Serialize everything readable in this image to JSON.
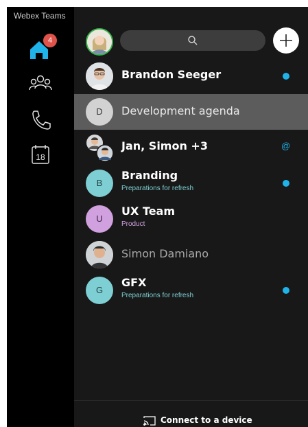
{
  "app": {
    "title": "Webex Teams"
  },
  "sidebar": {
    "items": [
      {
        "name": "home",
        "icon": "home-icon",
        "badge": "4",
        "color": "#20b3ea"
      },
      {
        "name": "teams",
        "icon": "people-icon"
      },
      {
        "name": "calls",
        "icon": "phone-icon"
      },
      {
        "name": "meetings",
        "icon": "calendar-icon",
        "label": "18"
      }
    ]
  },
  "header": {
    "search_icon": "search-icon",
    "add_icon": "plus-icon"
  },
  "spaces": [
    {
      "name": "Brandon Seeger",
      "style": "bold",
      "avatar": "photo",
      "unread": "dot"
    },
    {
      "name": "Development agenda",
      "style": "light",
      "avatar_initial": "D",
      "avatar_color": "#d2d2d2",
      "selected": true
    },
    {
      "name": "Jan, Simon +3",
      "style": "bold",
      "avatar": "group-photo",
      "unread": "@"
    },
    {
      "name": "Branding",
      "style": "bold",
      "avatar_initial": "B",
      "avatar_color": "#7ecfd3",
      "subtitle": "Preparations for refresh",
      "subtitle_color": "#7ecfd3",
      "unread": "dot"
    },
    {
      "name": "UX Team",
      "style": "bold",
      "avatar_initial": "U",
      "avatar_color": "#d1a0df",
      "subtitle": "Product",
      "subtitle_color": "#d1a0df"
    },
    {
      "name": "Simon Damiano",
      "style": "dim",
      "avatar": "photo"
    },
    {
      "name": "GFX",
      "style": "bold",
      "avatar_initial": "G",
      "avatar_color": "#7ecfd3",
      "subtitle": "Preparations for refresh",
      "subtitle_color": "#7ecfd3",
      "unread": "dot"
    }
  ],
  "footer": {
    "connect_label": "Connect to a device",
    "icon": "cast-icon"
  },
  "colors": {
    "accent": "#20b3ea",
    "badge": "#e0534a",
    "presence": "#36b24a"
  }
}
